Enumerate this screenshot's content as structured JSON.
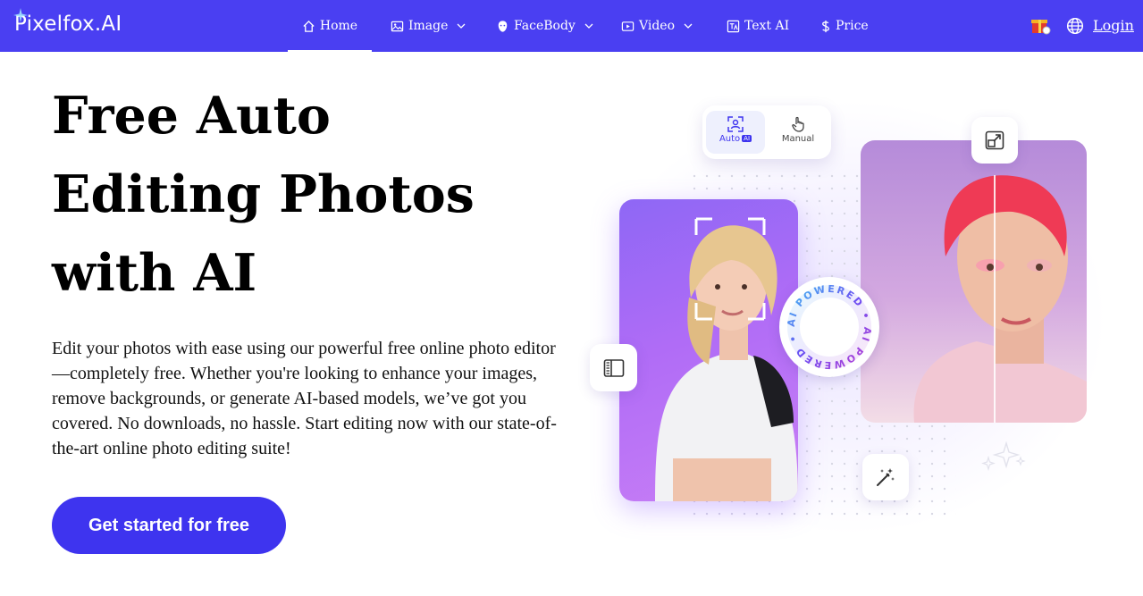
{
  "brand": {
    "name": "Pixelfox.AI"
  },
  "nav": {
    "items": [
      {
        "label": "Home",
        "icon": "home-icon",
        "dropdown": false
      },
      {
        "label": "Image",
        "icon": "image-icon",
        "dropdown": true
      },
      {
        "label": "FaceBody",
        "icon": "face-icon",
        "dropdown": true
      },
      {
        "label": "Video",
        "icon": "video-icon",
        "dropdown": true
      },
      {
        "label": "Text AI",
        "icon": "text-ai-icon",
        "dropdown": false
      },
      {
        "label": "Price",
        "icon": "dollar-icon",
        "dropdown": false
      }
    ],
    "login_label": "Login"
  },
  "hero": {
    "title": "Free Auto Editing Photos with AI",
    "description": "Edit your photos with ease using our powerful free online photo editor—completely free. Whether you're looking to enhance your images, remove backgrounds, or generate AI-based models, we’ve got you covered. No downloads, no hassle. Start editing now with our state-of-the-art online photo editing suite!",
    "cta_label": "Get started for free"
  },
  "illustration": {
    "mode_auto_label": "Auto",
    "mode_auto_badge": "AI",
    "mode_manual_label": "Manual",
    "ring_text": "AI POWERED • AI POWERED •"
  },
  "colors": {
    "primary": "#4a3ff2",
    "cta": "#3e34ef"
  }
}
